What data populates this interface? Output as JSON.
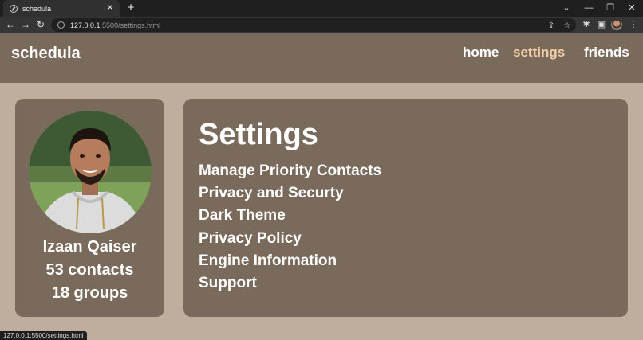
{
  "browser": {
    "tab_title": "schedula",
    "tab_close": "✕",
    "new_tab": "+",
    "url_host": "127.0.0.1",
    "url_path": ":5500/settings.html",
    "status_url": "127.0.0.1:5500/settings.html",
    "window_controls": {
      "dropdown": "⌄",
      "minimize": "—",
      "restore": "❐",
      "close": "✕"
    },
    "nav": {
      "back": "←",
      "forward": "→",
      "reload": "↻"
    }
  },
  "site": {
    "brand": "schedula",
    "nav": [
      {
        "label": "home",
        "active": false
      },
      {
        "label": "settings",
        "active": true
      },
      {
        "label": "friends",
        "active": false
      }
    ]
  },
  "profile": {
    "name": "Izaan Qaiser",
    "contacts": "53 contacts",
    "groups": "18 groups"
  },
  "settings": {
    "title": "Settings",
    "items": [
      "Manage Priority Contacts",
      "Privacy and Securty",
      "Dark Theme",
      "Privacy Policy",
      "Engine Information",
      "Support"
    ]
  },
  "colors": {
    "page_bg": "#bfae9e",
    "panel_bg": "#7a6a5c",
    "active_nav": "#f2cfa7",
    "text": "#ffffff"
  }
}
